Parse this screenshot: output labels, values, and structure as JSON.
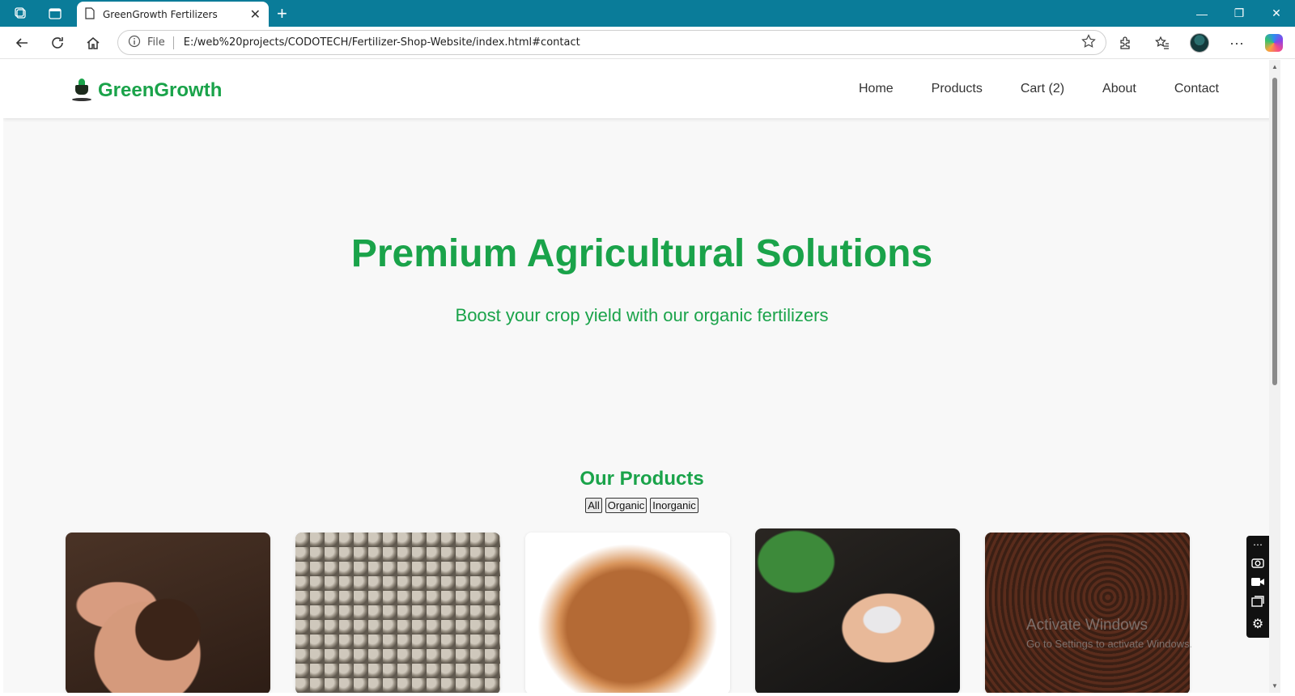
{
  "browser": {
    "tab_title": "GreenGrowth Fertilizers",
    "url_scheme_label": "File",
    "url": "E:/web%20projects/CODOTECH/Fertilizer-Shop-Website/index.html#contact"
  },
  "site": {
    "brand": "GreenGrowth",
    "nav": [
      {
        "label": "Home"
      },
      {
        "label": "Products"
      },
      {
        "label": "Cart (2)"
      },
      {
        "label": "About"
      },
      {
        "label": "Contact"
      }
    ]
  },
  "hero": {
    "title": "Premium Agricultural Solutions",
    "subtitle": "Boost your crop yield with our organic fertilizers"
  },
  "products": {
    "heading": "Our Products",
    "filters": [
      "All",
      "Organic",
      "Inorganic"
    ],
    "cards": [
      {
        "image": "soil-in-hands"
      },
      {
        "image": "fertilizer-pellets"
      },
      {
        "image": "coco-coir"
      },
      {
        "image": "granules-in-hand"
      },
      {
        "image": "vermicompost-worms"
      }
    ]
  },
  "watermark": {
    "line1": "Activate Windows",
    "line2": "Go to Settings to activate Windows."
  },
  "colors": {
    "brand_green": "#1aa34a",
    "tabbar": "#0a7c99"
  }
}
